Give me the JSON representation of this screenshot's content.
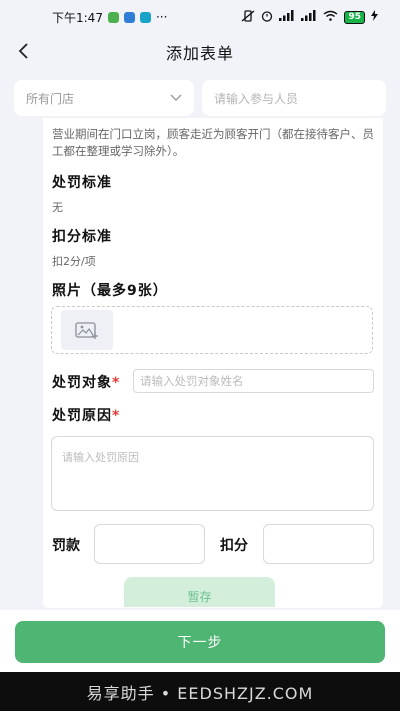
{
  "status_bar": {
    "time": "下午1:47",
    "app_icon_colors": [
      "#4cb04f",
      "#2f7fd6",
      "#1aa3c9"
    ],
    "more": "···",
    "battery": "95"
  },
  "navbar": {
    "title": "添加表单"
  },
  "filters": {
    "store_value": "所有门店",
    "participant_placeholder": "请输入参与人员"
  },
  "rule": {
    "text": "营业期间在门口立岗，顾客走近为顾客开门（都在接待客户、员工都在整理或学习除外）。"
  },
  "penalty_standard": {
    "label": "处罚标准",
    "value": "无"
  },
  "deduction_standard": {
    "label": "扣分标准",
    "value": "扣2分/项"
  },
  "photos": {
    "label": "照片（最多9张）"
  },
  "penalty_target": {
    "label": "处罚对象",
    "required_mark": "*",
    "placeholder": "请输入处罚对象姓名"
  },
  "penalty_reason": {
    "label": "处罚原因",
    "required_mark": "*",
    "placeholder": "请输入处罚原因"
  },
  "fine": {
    "label": "罚款"
  },
  "points": {
    "label": "扣分"
  },
  "actions": {
    "draft_label": "暂存",
    "next_label": "下一步"
  },
  "watermark": "易享助手 • EEDSHZJZ.COM",
  "colors": {
    "primary": "#4fb572",
    "draft_bg": "#d4eedc",
    "required": "#e53935",
    "page_bg": "#f1f3f8"
  }
}
